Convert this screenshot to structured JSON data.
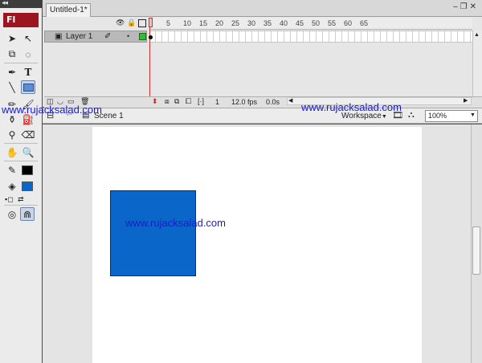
{
  "document": {
    "tab_title": "Untitled-1*"
  },
  "app": {
    "logo": "Fl"
  },
  "timeline": {
    "layer_name": "Layer 1",
    "frame_numbers": [
      "5",
      "10",
      "15",
      "20",
      "25",
      "30",
      "35",
      "40",
      "45",
      "50",
      "55",
      "60",
      "65"
    ],
    "status": {
      "current_frame": "1",
      "frame_rate": "12.0 fps",
      "elapsed_time": "0.0s"
    }
  },
  "edit_bar": {
    "scene_label": "Scene 1",
    "workspace_label": "Workspace",
    "zoom_value": "100%"
  },
  "watermark": "www.rujacksalad.com",
  "colors": {
    "shape_fill": "#0a66c8",
    "stroke_swatch": "#000000",
    "fill_swatch": "#0a66c8",
    "logo_bg": "#9b1420"
  }
}
